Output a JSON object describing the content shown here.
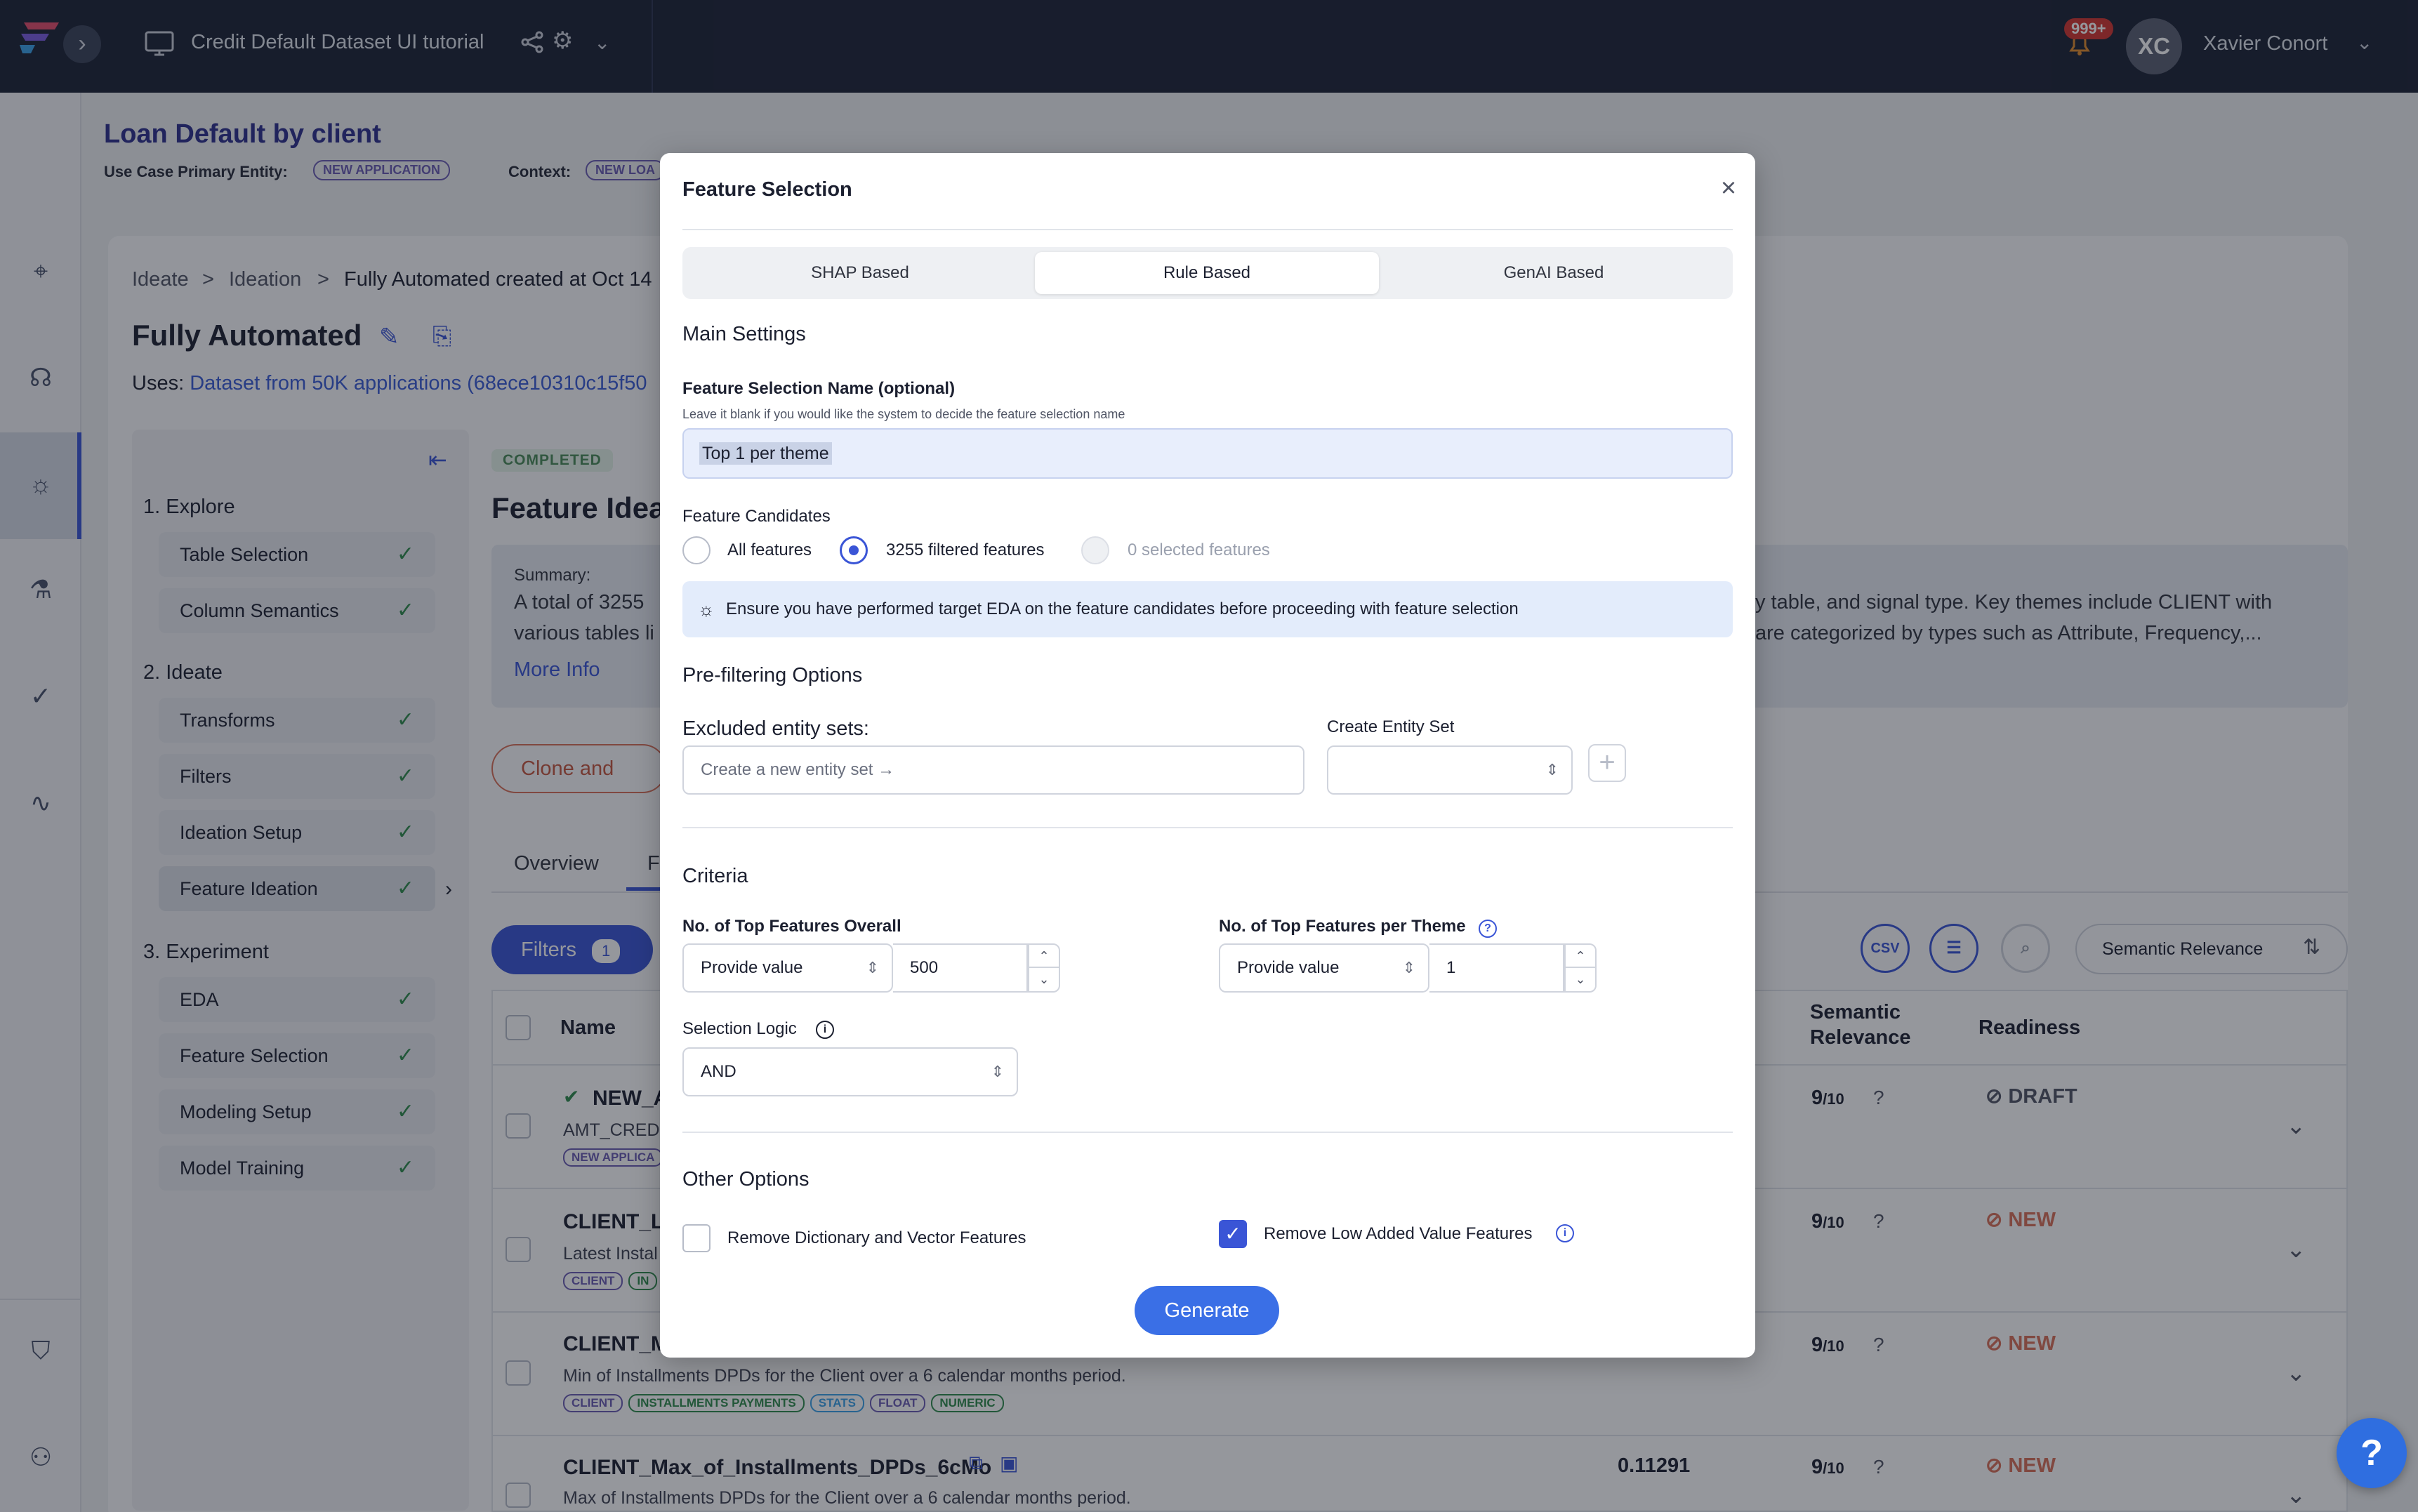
{
  "topbar": {
    "title": "Credit Default Dataset UI tutorial",
    "notifications": "999+",
    "avatar": "XC",
    "user": "Xavier Conort"
  },
  "page": {
    "title": "Loan Default by client",
    "primary_entity_label": "Use Case Primary Entity:",
    "primary_entity": "NEW APPLICATION",
    "context_label": "Context:",
    "context_chip": "NEW LOA"
  },
  "breadcrumb": [
    "Ideate",
    "Ideation",
    "Fully Automated created at Oct 14"
  ],
  "heading": "Fully Automated",
  "uses": {
    "label": "Uses:",
    "link": "Dataset from 50K applications (68ece10310c15f50"
  },
  "steps": {
    "explore": "1. Explore",
    "explore_items": [
      "Table Selection",
      "Column Semantics"
    ],
    "ideate": "2. Ideate",
    "ideate_items": [
      "Transforms",
      "Filters",
      "Ideation Setup",
      "Feature Ideation"
    ],
    "experiment": "3. Experiment",
    "experiment_items": [
      "EDA",
      "Feature Selection",
      "Modeling Setup",
      "Model Training"
    ]
  },
  "background": {
    "completed": "COMPLETED",
    "feature_heading": "Feature Idea",
    "summary_label": "Summary:",
    "summary_left1": "A total of 3255",
    "summary_left2": "various tables li",
    "summary_right1": "y table, and signal type. Key themes include CLIENT with",
    "summary_right2": "are categorized by types such as Attribute, Frequency,...",
    "more_info": "More Info",
    "clone": "Clone and Rese",
    "tab_overview": "Overview",
    "tab_f": "F",
    "filters": "Filters",
    "filters_count": "1",
    "sort": "Semantic Relevance",
    "col_name": "Name",
    "col_semantic": "Semantic",
    "col_relevance": "Relevance",
    "col_readiness": "Readiness",
    "csv": "CSV"
  },
  "rows": [
    {
      "name": "NEW_A",
      "desc": "AMT_CREDI",
      "score": "9",
      "denom": "/10",
      "status": "DRAFT",
      "tags": [
        "NEW APPLICA"
      ]
    },
    {
      "name": "CLIENT_La",
      "desc": "Latest Instal",
      "score": "9",
      "denom": "/10",
      "status": "NEW",
      "tags": [
        "CLIENT",
        "IN"
      ]
    },
    {
      "name": "CLIENT_M",
      "desc": "Min of Installments DPDs for the Client over a 6 calendar months period.",
      "score": "9",
      "denom": "/10",
      "status": "NEW",
      "tags": [
        "CLIENT",
        "INSTALLMENTS PAYMENTS",
        "STATS",
        "FLOAT",
        "NUMERIC"
      ]
    },
    {
      "name": "CLIENT_Max_of_Installments_DPDs_6cMo",
      "desc": "Max of Installments DPDs for the Client over a 6 calendar months period.",
      "value": "0.11291",
      "score": "9",
      "denom": "/10",
      "status": "NEW"
    }
  ],
  "modal": {
    "title": "Feature Selection",
    "tabs": [
      "SHAP Based",
      "Rule Based",
      "GenAI Based"
    ],
    "main_settings": "Main Settings",
    "name_label": "Feature Selection Name (optional)",
    "name_help": "Leave it blank if you would like the system to decide the feature selection name",
    "name_value": "Top 1 per theme",
    "candidates_label": "Feature Candidates",
    "candidates": [
      "All features",
      "3255 filtered features",
      "0 selected features"
    ],
    "info": "Ensure you have performed target EDA on the feature candidates before proceeding with feature selection",
    "prefilter": "Pre-filtering Options",
    "excluded_label": "Excluded entity sets:",
    "excluded_placeholder": "Create a new entity set →",
    "create_entity_label": "Create Entity Set",
    "criteria": "Criteria",
    "top_overall_label": "No. of Top Features Overall",
    "top_overall_mode": "Provide value",
    "top_overall_value": "500",
    "top_theme_label": "No. of Top Features per Theme",
    "top_theme_mode": "Provide value",
    "top_theme_value": "1",
    "logic_label": "Selection Logic",
    "logic_value": "AND",
    "other": "Other Options",
    "opt_dict": "Remove Dictionary and Vector Features",
    "opt_low": "Remove Low Added Value Features",
    "generate": "Generate"
  },
  "help": "?"
}
